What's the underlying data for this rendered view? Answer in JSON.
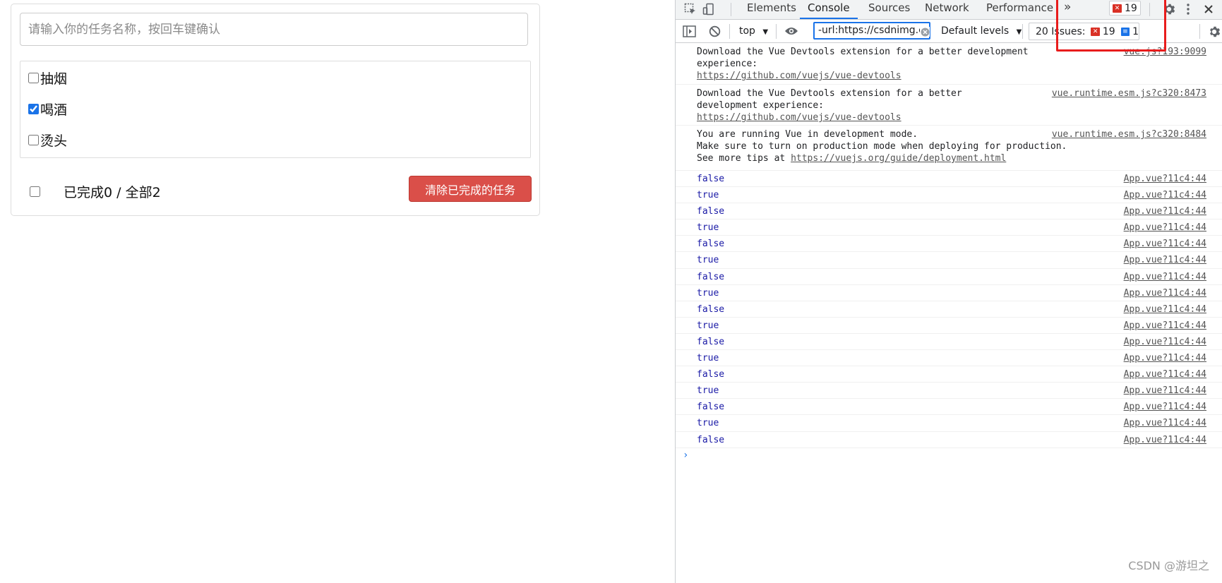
{
  "app": {
    "input_placeholder": "请输入你的任务名称，按回车键确认",
    "items": [
      {
        "label": "抽烟",
        "done": false
      },
      {
        "label": "喝酒",
        "done": true
      },
      {
        "label": "烫头",
        "done": false
      }
    ],
    "footer_text": "已完成0 / 全部2",
    "clear_button": "清除已完成的任务"
  },
  "devtools": {
    "tabs": [
      "Elements",
      "Console",
      "Sources",
      "Network",
      "Performance"
    ],
    "active_tab": "Console",
    "more_tabs": "»",
    "error_count": "19",
    "toolbar": {
      "context": "top",
      "filter_value": "-url:https://csdnimg.cn",
      "levels": "Default levels",
      "issues_label": "20 Issues:",
      "issues_errors": "19",
      "issues_info": "1"
    },
    "messages": [
      {
        "lines": [
          "Download the Vue Devtools extension for a better development",
          "experience:"
        ],
        "link": "https://github.com/vuejs/vue-devtools",
        "source": "vue.js?193:9099"
      },
      {
        "lines": [
          "Download the Vue Devtools extension for a better",
          "development experience:"
        ],
        "link": "https://github.com/vuejs/vue-devtools",
        "source": "vue.runtime.esm.js?c320:8473"
      },
      {
        "lines": [
          "You are running Vue in development mode.",
          "Make sure to turn on production mode when deploying for production."
        ],
        "tip_prefix": "See more tips at ",
        "link": "https://vuejs.org/guide/deployment.html",
        "source": "vue.runtime.esm.js?c320:8484"
      }
    ],
    "log_source": "App.vue?11c4:44",
    "logs": [
      "false",
      "true",
      "false",
      "true",
      "false",
      "true",
      "false",
      "true",
      "false",
      "true",
      "false",
      "true",
      "false",
      "true",
      "false",
      "true",
      "false"
    ],
    "prompt": "›"
  },
  "watermark": "CSDN @游坦之"
}
